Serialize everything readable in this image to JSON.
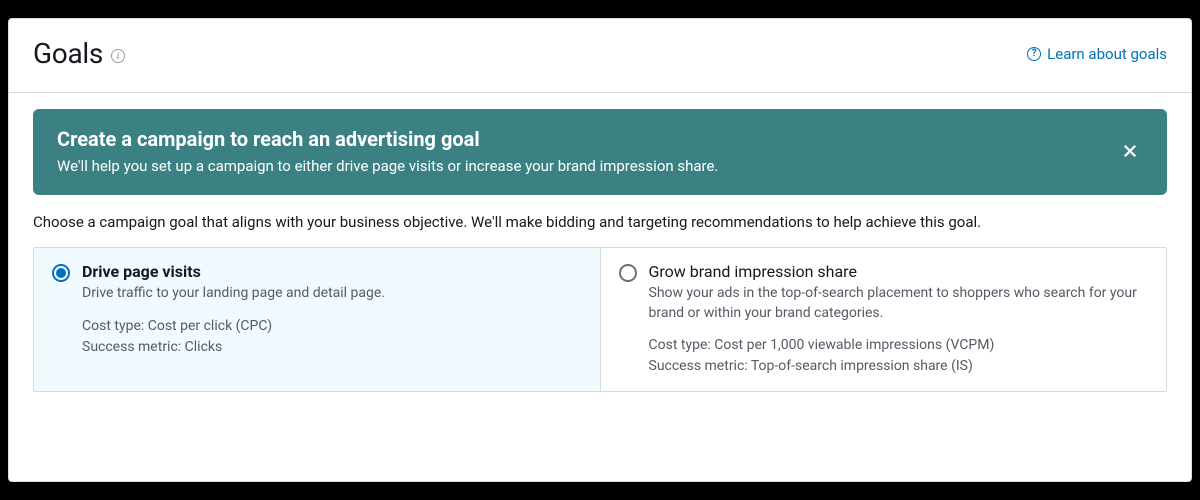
{
  "header": {
    "title": "Goals",
    "help_link": "Learn about goals"
  },
  "banner": {
    "title": "Create a campaign to reach an advertising goal",
    "subtitle": "We'll help you set up a campaign to either drive page visits or increase your brand impression share."
  },
  "instruction": "Choose a campaign goal that aligns with your business objective. We'll make bidding and targeting recommendations to help achieve this goal.",
  "options": [
    {
      "title": "Drive page visits",
      "desc": "Drive traffic to your landing page and detail page.",
      "cost_label": "Cost type: Cost per click (CPC)",
      "metric_label": "Success metric: Clicks",
      "selected": true
    },
    {
      "title": "Grow brand impression share",
      "desc": "Show your ads in the top-of-search placement to shoppers who search for your brand or within your brand categories.",
      "cost_label": "Cost type: Cost per 1,000 viewable impressions (VCPM)",
      "metric_label": "Success metric: Top-of-search impression share (IS)",
      "selected": false
    }
  ]
}
